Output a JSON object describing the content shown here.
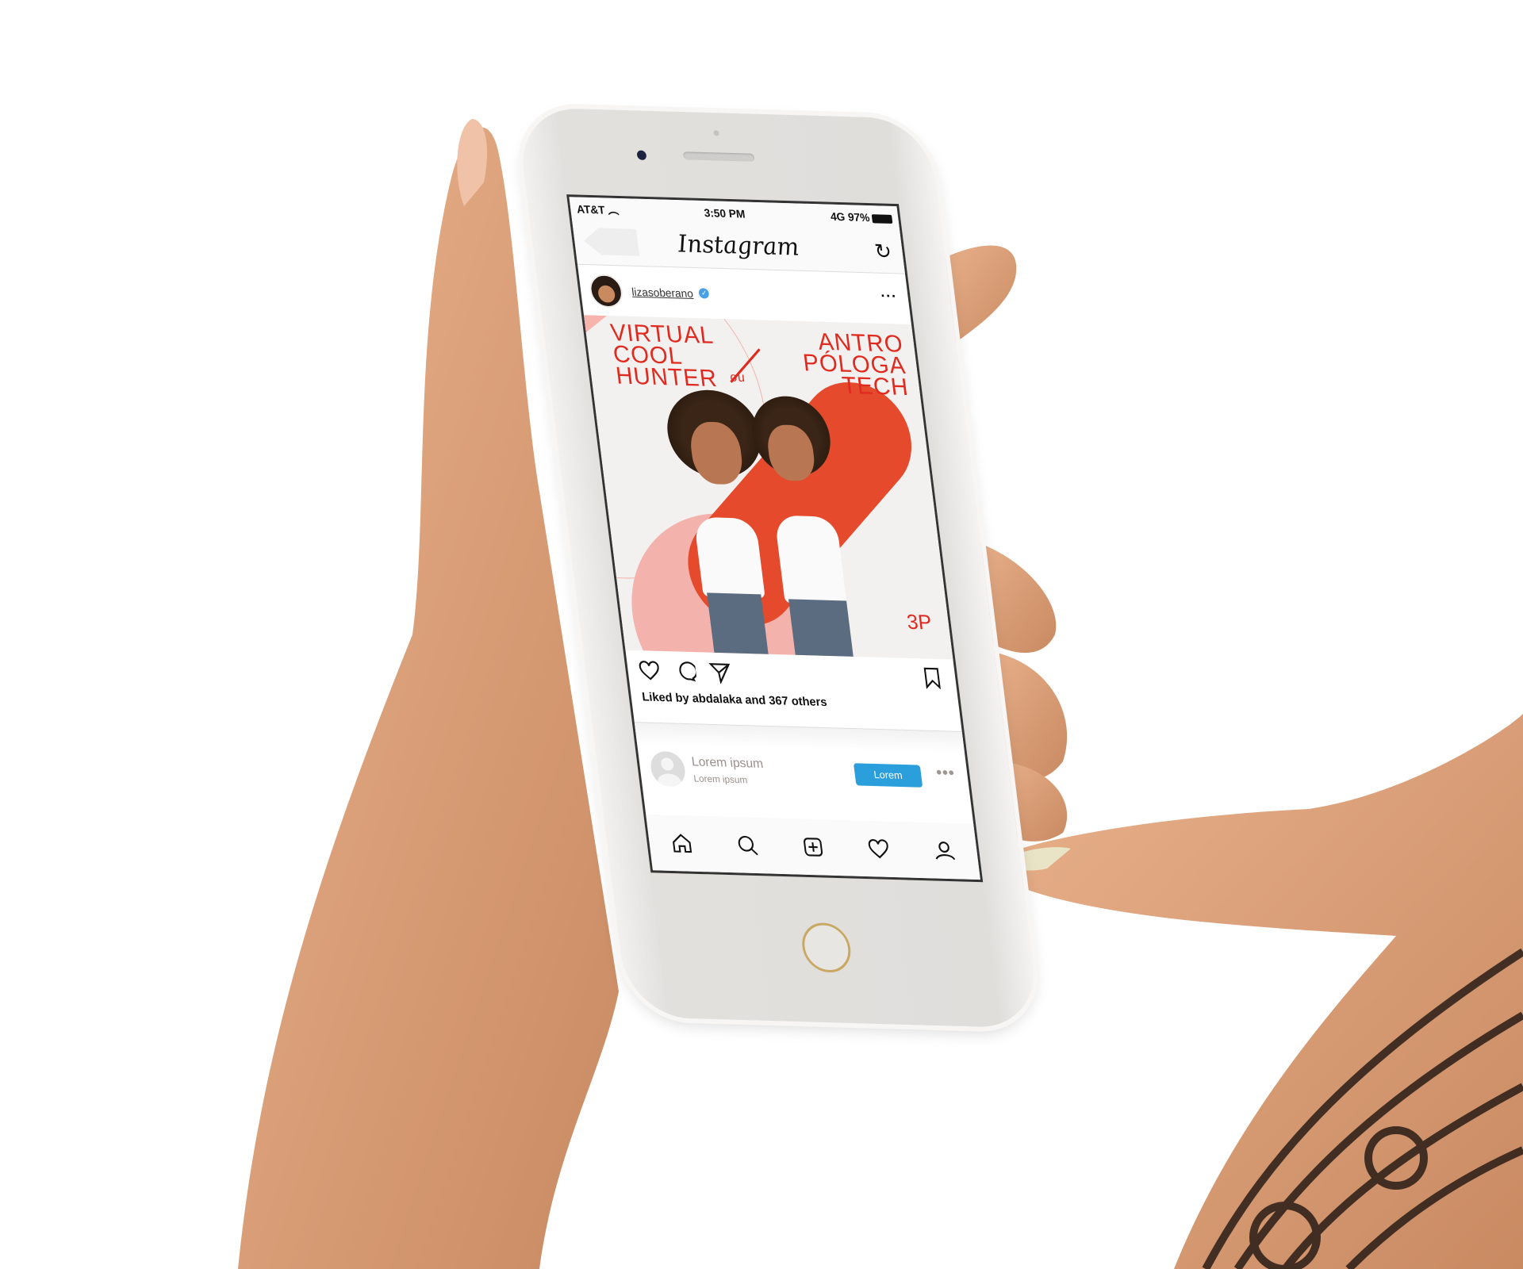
{
  "status_bar": {
    "carrier": "AT&T",
    "time": "3:50 PM",
    "network": "4G",
    "battery": "97%"
  },
  "nav": {
    "title": "Instagram"
  },
  "post": {
    "username": "lizasoberano",
    "image_text": {
      "left": [
        "VIRTUAL",
        "COOL",
        "HUNTER"
      ],
      "middle": "ou",
      "right": [
        "ANTRO",
        "PÓLOGA",
        "TECH"
      ],
      "brand": "3P"
    },
    "likes": "Liked by abdalaka and 367 others"
  },
  "suggestion": {
    "name": "Lorem ipsum",
    "subtitle": "Lorem ipsum",
    "button": "Lorem"
  },
  "colors": {
    "accent_red": "#e12a1f",
    "button_blue": "#2b9fdc"
  }
}
